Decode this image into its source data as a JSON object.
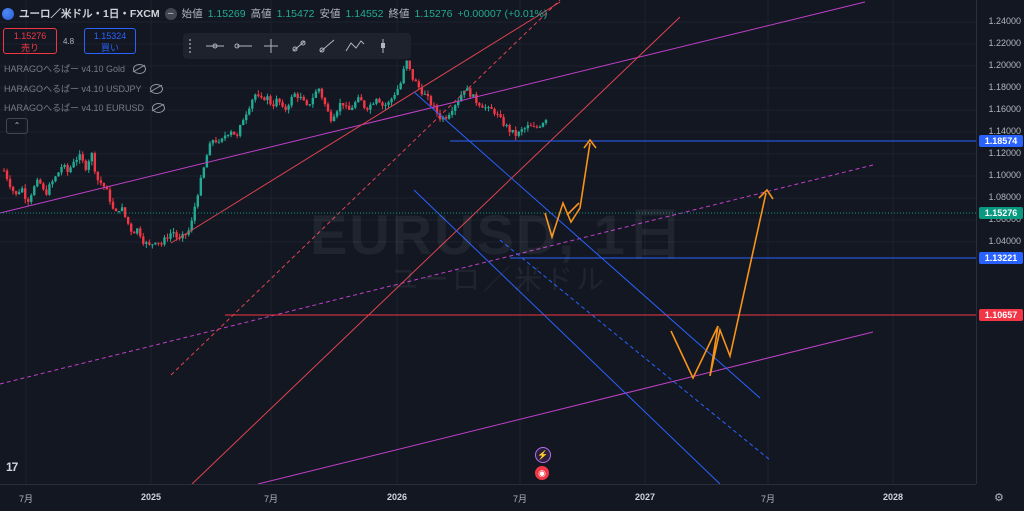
{
  "header": {
    "symbol_title": "ユーロ／米ドル・1日・FXCM",
    "open_label": "始値",
    "open_value": "1.15269",
    "high_label": "高値",
    "high_value": "1.15472",
    "low_label": "安値",
    "low_value": "1.14552",
    "close_label": "終値",
    "close_value": "1.15276",
    "change": "+0.00007 (+0.01%)"
  },
  "trade": {
    "sell_price": "1.15276",
    "sell_label": "売り",
    "spread": "4.8",
    "buy_price": "1.15324",
    "buy_label": "買い"
  },
  "indicators": [
    "HARAGOへるぱー v4.10 Gold",
    "HARAGOへるぱー v4.10 USDJPY",
    "HARAGOへるぱー v4.10 EURUSD"
  ],
  "toolbar_icons": [
    "line-tool-icon",
    "ray-tool-icon",
    "crosshair-tool-icon",
    "trend-line-icon",
    "extended-line-icon",
    "path-tool-icon",
    "brush-tool-icon",
    "cursor-tool-icon"
  ],
  "watermark": {
    "main": "EURUSD, 1日",
    "sub": "ユーロ／米ドル"
  },
  "colors": {
    "bg": "#131722",
    "up": "#22ab94",
    "down": "#f23645",
    "blue_tag": "#2962ff",
    "teal_tag": "#089981",
    "red_tag": "#f23645",
    "orange": "#f7931a",
    "magenta": "#c040c8"
  },
  "chart_data": {
    "type": "candlestick",
    "y_ticks": [
      "1.24000",
      "1.22000",
      "1.20000",
      "1.18000",
      "1.16000",
      "1.14000",
      "1.12000",
      "1.10000",
      "1.08000",
      "1.06000",
      "1.04000"
    ],
    "x_ticks": [
      {
        "label": "7月",
        "bold": false
      },
      {
        "label": "2025",
        "bold": true
      },
      {
        "label": "7月",
        "bold": false
      },
      {
        "label": "2026",
        "bold": true
      },
      {
        "label": "7月",
        "bold": false
      },
      {
        "label": "2027",
        "bold": true
      },
      {
        "label": "7月",
        "bold": false
      },
      {
        "label": "2028",
        "bold": true
      }
    ],
    "price_tags": [
      {
        "value": "1.18574",
        "color": "#2962ff"
      },
      {
        "value": "1.15276",
        "color": "#089981"
      },
      {
        "value": "1.13221",
        "color": "#2962ff"
      },
      {
        "value": "1.10657",
        "color": "#f23645"
      }
    ],
    "ylim": [
      1.03,
      1.245
    ],
    "price_path": [
      1.105,
      1.093,
      1.082,
      1.09,
      1.077,
      1.088,
      1.096,
      1.083,
      1.092,
      1.1,
      1.11,
      1.103,
      1.115,
      1.117,
      1.108,
      1.121,
      1.097,
      1.092,
      1.082,
      1.064,
      1.073,
      1.06,
      1.049,
      1.052,
      1.04,
      1.036,
      1.042,
      1.038,
      1.045,
      1.05,
      1.041,
      1.046,
      1.052,
      1.08,
      1.1,
      1.123,
      1.135,
      1.128,
      1.138,
      1.142,
      1.135,
      1.152,
      1.163,
      1.175,
      1.168,
      1.173,
      1.164,
      1.17,
      1.158,
      1.168,
      1.175,
      1.17,
      1.162,
      1.172,
      1.18,
      1.166,
      1.152,
      1.16,
      1.168,
      1.158,
      1.165,
      1.17,
      1.162,
      1.165,
      1.173,
      1.164,
      1.166,
      1.175,
      1.183,
      1.205,
      1.19,
      1.182,
      1.175,
      1.168,
      1.16,
      1.152,
      1.155,
      1.163,
      1.17,
      1.18,
      1.175,
      1.168,
      1.165,
      1.16,
      1.16,
      1.152,
      1.146,
      1.14,
      1.137,
      1.142,
      1.145,
      1.143,
      1.147,
      1.1528
    ]
  }
}
